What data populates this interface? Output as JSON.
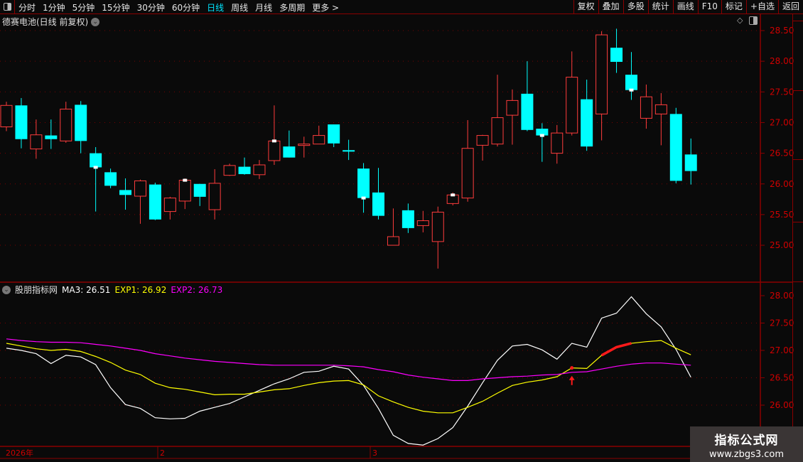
{
  "toolbar": {
    "periods": [
      "分时",
      "1分钟",
      "5分钟",
      "15分钟",
      "30分钟",
      "60分钟",
      "日线",
      "周线",
      "月线",
      "多周期",
      "更多 >"
    ],
    "active_period": "日线",
    "buttons": [
      "复权",
      "叠加",
      "多股",
      "统计",
      "画线",
      "F10",
      "标记",
      "+自选",
      "返回"
    ]
  },
  "main": {
    "title": "德赛电池(日线 前复权)",
    "price_ticks": [
      "28.50",
      "28.00",
      "27.50",
      "27.00",
      "26.50",
      "26.00",
      "25.50",
      "25.00"
    ]
  },
  "indicator": {
    "name": "股朋指标网",
    "ma3_label": "MA3: 26.51",
    "exp1_label": "EXP1: 26.92",
    "exp2_label": "EXP2: 26.73",
    "ticks": [
      "28.00",
      "27.50",
      "27.00",
      "26.50",
      "26.00"
    ]
  },
  "date_axis": {
    "labels": [
      "2026年",
      "2",
      "3"
    ]
  },
  "watermark": {
    "line1": "指标公式网",
    "line2": "www.zbgs3.com"
  },
  "colors": {
    "up": "#ff3c3c",
    "down": "#00ffff",
    "ma3": "#ffffff",
    "exp1": "#ffff00",
    "exp2": "#ff00ff",
    "axis": "#d00000",
    "grid": "#7a0000"
  },
  "chart_data": [
    {
      "type": "candlestick",
      "ylim": [
        24.6,
        28.55
      ],
      "candles": [
        [
          26.93,
          27.34,
          26.86,
          27.28
        ],
        [
          27.28,
          27.4,
          26.58,
          26.73
        ],
        [
          26.57,
          27.05,
          26.41,
          26.8
        ],
        [
          26.79,
          27.05,
          26.57,
          26.73
        ],
        [
          26.7,
          27.34,
          26.67,
          27.22
        ],
        [
          27.29,
          27.35,
          26.5,
          26.7
        ],
        [
          26.5,
          26.6,
          25.55,
          26.27
        ],
        [
          26.19,
          26.25,
          25.93,
          25.97
        ],
        [
          25.9,
          26.09,
          25.58,
          25.82
        ],
        [
          25.8,
          26.07,
          25.35,
          26.05
        ],
        [
          25.99,
          26.02,
          25.41,
          25.42
        ],
        [
          25.55,
          25.79,
          25.42,
          25.77
        ],
        [
          25.72,
          26.09,
          25.59,
          26.06
        ],
        [
          26.0,
          26.0,
          25.64,
          25.79
        ],
        [
          25.58,
          26.24,
          25.42,
          26.01
        ],
        [
          26.14,
          26.33,
          26.13,
          26.3
        ],
        [
          26.28,
          26.43,
          26.15,
          26.16
        ],
        [
          26.15,
          26.39,
          26.08,
          26.31
        ],
        [
          26.38,
          27.28,
          26.31,
          26.7
        ],
        [
          26.61,
          26.87,
          26.43,
          26.43
        ],
        [
          26.63,
          26.77,
          26.43,
          26.65
        ],
        [
          26.65,
          26.95,
          26.65,
          26.79
        ],
        [
          26.97,
          26.97,
          26.6,
          26.66
        ],
        [
          26.55,
          26.72,
          26.39,
          26.53
        ],
        [
          26.25,
          26.34,
          25.53,
          25.77
        ],
        [
          25.86,
          26.26,
          25.42,
          25.48
        ],
        [
          25.0,
          25.6,
          25.0,
          25.14
        ],
        [
          25.57,
          25.68,
          25.2,
          25.28
        ],
        [
          25.32,
          25.56,
          25.21,
          25.4
        ],
        [
          25.06,
          25.63,
          24.62,
          25.54
        ],
        [
          25.68,
          25.86,
          25.65,
          25.82
        ],
        [
          25.77,
          27.04,
          25.71,
          26.58
        ],
        [
          26.63,
          26.8,
          26.38,
          26.79
        ],
        [
          26.65,
          27.78,
          26.61,
          27.08
        ],
        [
          27.12,
          27.54,
          26.64,
          27.36
        ],
        [
          27.47,
          28.0,
          26.86,
          26.88
        ],
        [
          26.9,
          26.99,
          26.36,
          26.79
        ],
        [
          26.5,
          26.96,
          26.33,
          26.83
        ],
        [
          26.83,
          28.16,
          26.79,
          27.74
        ],
        [
          27.38,
          27.7,
          26.54,
          26.61
        ],
        [
          27.14,
          28.49,
          26.71,
          28.43
        ],
        [
          28.22,
          28.53,
          27.81,
          27.99
        ],
        [
          27.78,
          28.15,
          27.37,
          27.53
        ],
        [
          27.07,
          27.62,
          26.9,
          27.42
        ],
        [
          27.14,
          27.48,
          26.63,
          27.29
        ],
        [
          27.14,
          27.24,
          26.01,
          26.05
        ],
        [
          26.48,
          26.74,
          25.99,
          26.21
        ]
      ],
      "candle_fields": [
        "open",
        "high",
        "low",
        "close"
      ],
      "marker_indices": [
        6,
        12,
        18,
        24,
        30,
        36,
        42
      ],
      "grid": true
    },
    {
      "type": "line",
      "ylim": [
        25.2,
        28.1
      ],
      "series": [
        {
          "name": "MA3",
          "values": [
            27.04,
            27.0,
            26.94,
            26.76,
            26.91,
            26.88,
            26.74,
            26.32,
            26.01,
            25.94,
            25.77,
            25.75,
            25.76,
            25.89,
            25.96,
            26.03,
            26.15,
            26.27,
            26.39,
            26.48,
            26.6,
            26.62,
            26.71,
            26.66,
            26.36,
            25.94,
            25.45,
            25.3,
            25.27,
            25.39,
            25.59,
            25.98,
            26.41,
            26.82,
            27.08,
            27.11,
            27.01,
            26.84,
            27.13,
            27.06,
            27.59,
            27.68,
            27.98,
            27.67,
            27.43,
            27.02,
            26.51
          ]
        },
        {
          "name": "EXP1",
          "values": [
            27.13,
            27.08,
            27.03,
            27.0,
            27.02,
            26.98,
            26.89,
            26.78,
            26.64,
            26.56,
            26.4,
            26.32,
            26.29,
            26.24,
            26.19,
            26.2,
            26.2,
            26.24,
            26.28,
            26.3,
            26.36,
            26.41,
            26.44,
            26.45,
            26.37,
            26.17,
            26.06,
            25.96,
            25.89,
            25.86,
            25.86,
            25.96,
            26.07,
            26.22,
            26.36,
            26.42,
            26.46,
            26.52,
            26.68,
            26.67,
            26.91,
            27.06,
            27.13,
            27.16,
            27.18,
            27.04,
            26.92
          ]
        },
        {
          "name": "EXP2",
          "values": [
            27.21,
            27.18,
            27.16,
            27.15,
            27.15,
            27.14,
            27.11,
            27.08,
            27.04,
            27.0,
            26.94,
            26.9,
            26.86,
            26.83,
            26.8,
            26.78,
            26.76,
            26.74,
            26.73,
            26.73,
            26.73,
            26.73,
            26.73,
            26.72,
            26.7,
            26.65,
            26.61,
            26.55,
            26.51,
            26.48,
            26.45,
            26.45,
            26.48,
            26.5,
            26.52,
            26.53,
            26.55,
            26.56,
            26.6,
            26.61,
            26.66,
            26.71,
            26.75,
            26.77,
            26.77,
            26.75,
            26.73
          ]
        }
      ],
      "signal_dot_index": 38,
      "signal_arrow_index": 38,
      "highlight_range": [
        40,
        42
      ],
      "grid": true
    }
  ]
}
